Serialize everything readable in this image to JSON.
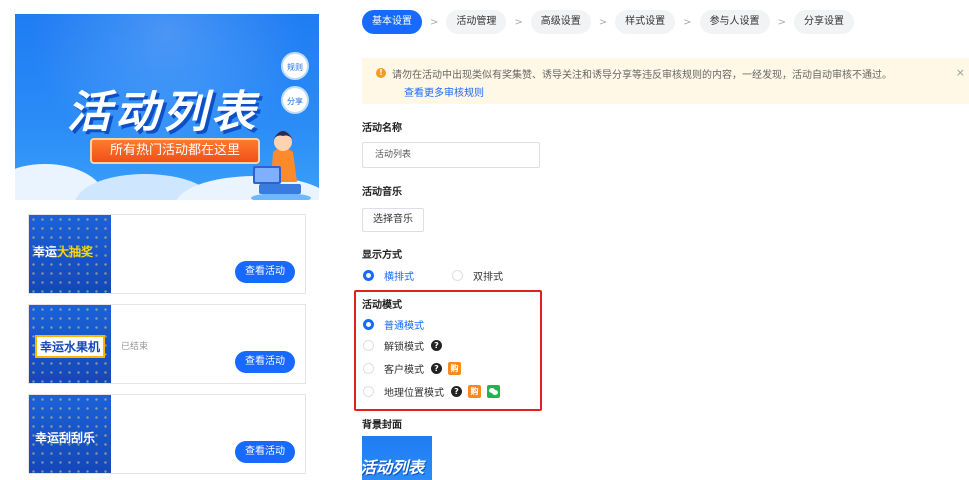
{
  "banner": {
    "title": "活动列表",
    "subtitle": "所有热门活动都在这里",
    "rules_label": "规则",
    "share_label": "分享"
  },
  "cards": [
    {
      "thumb_white": "幸运",
      "thumb_yellow": "大抽奖",
      "status": "",
      "button": "查看活动"
    },
    {
      "thumb_white": "幸运水果机",
      "thumb_yellow": "",
      "status": "已结束",
      "button": "查看活动"
    },
    {
      "thumb_white": "幸运刮刮乐",
      "thumb_yellow": "",
      "status": "",
      "button": "查看活动"
    }
  ],
  "steps": [
    {
      "label": "基本设置",
      "active": true
    },
    {
      "label": "活动管理",
      "active": false
    },
    {
      "label": "高级设置",
      "active": false
    },
    {
      "label": "样式设置",
      "active": false
    },
    {
      "label": "参与人设置",
      "active": false
    },
    {
      "label": "分享设置",
      "active": false
    }
  ],
  "step_separator": ">",
  "notice": {
    "message": "请勿在活动中出现类似有奖集赞、诱导关注和诱导分享等违反审核规则的内容，一经发现，活动自动审核不通过。",
    "link": "查看更多审核规则",
    "close": "×"
  },
  "form": {
    "name_label": "活动名称",
    "name_value": "活动列表",
    "music_label": "活动音乐",
    "music_button": "选择音乐",
    "display_label": "显示方式",
    "display_options": [
      {
        "label": "横排式",
        "selected": true
      },
      {
        "label": "双排式",
        "selected": false
      }
    ],
    "mode_label": "活动模式",
    "mode_options": [
      {
        "label": "普通模式",
        "selected": true
      },
      {
        "label": "解锁模式",
        "selected": false
      },
      {
        "label": "客户模式",
        "selected": false
      },
      {
        "label": "地理位置模式",
        "selected": false
      }
    ],
    "help_glyph": "?",
    "buy_glyph": "购",
    "cover_label": "背景封面",
    "cover_text": "活动列表"
  },
  "colors": {
    "primary": "#1769ff",
    "warning": "#f59a23",
    "highlight_border": "#e02020",
    "buy_badge": "#f58b1f",
    "wechat_badge": "#1fb54c"
  },
  "icons": [
    "warning-icon",
    "close-icon",
    "help-icon",
    "buy-badge-icon",
    "wechat-icon",
    "radio-icon"
  ]
}
